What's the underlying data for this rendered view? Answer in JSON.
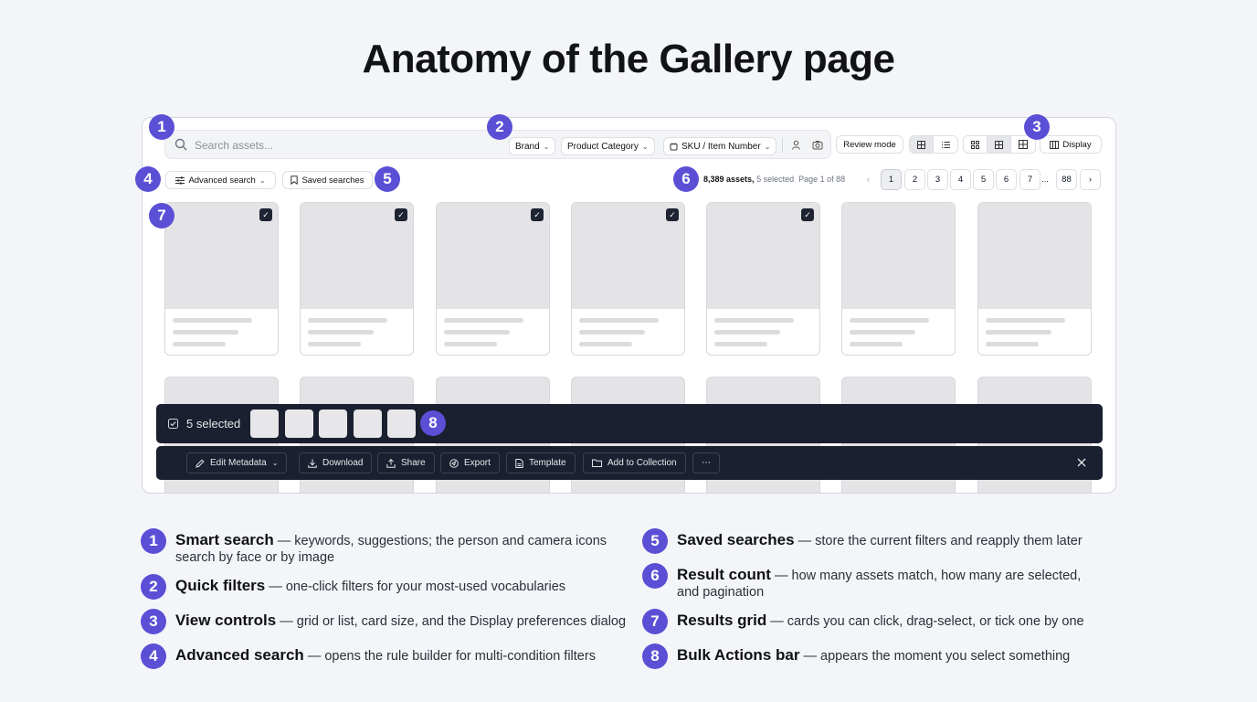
{
  "title": "Anatomy of the Gallery page",
  "search": {
    "placeholder": "Search assets...",
    "chips": [
      "Brand",
      "Product Category",
      "SKU / Item Number"
    ]
  },
  "toolbar": {
    "review_mode": "Review mode",
    "display": "Display",
    "advanced_search": "Advanced search",
    "saved_searches": "Saved searches"
  },
  "results": {
    "count": "8,389 assets,",
    "selected": "5 selected",
    "page_info": "Page 1 of 88",
    "pages": [
      "1",
      "2",
      "3",
      "4",
      "5",
      "6",
      "7"
    ],
    "ellipsis": "...",
    "last_page": "88",
    "current_page": 1
  },
  "bulk": {
    "selected_label": "5 selected",
    "actions": [
      "Edit Metadata",
      "Download",
      "Share",
      "Export",
      "Template",
      "Add to Collection"
    ],
    "more": "⋯"
  },
  "badges": [
    "1",
    "2",
    "3",
    "4",
    "5",
    "6",
    "7",
    "8"
  ],
  "legend": [
    {
      "num": "1",
      "term": "Smart search",
      "desc": " — keywords, suggestions; the person and camera icons search by face or by image"
    },
    {
      "num": "2",
      "term": "Quick filters",
      "desc": " — one-click filters for your most-used vocabularies"
    },
    {
      "num": "3",
      "term": "View controls",
      "desc": " — grid or list, card size, and the Display preferences dialog"
    },
    {
      "num": "4",
      "term": "Advanced search",
      "desc": " — opens the rule builder for multi-condition filters"
    },
    {
      "num": "5",
      "term": "Saved searches",
      "desc": " — store the current filters and reapply them later"
    },
    {
      "num": "6",
      "term": "Result count",
      "desc": " — how many assets match, how many are selected, and pagination"
    },
    {
      "num": "7",
      "term": "Results grid",
      "desc": " — cards you can click, drag-select, or tick one by one"
    },
    {
      "num": "8",
      "term": "Bulk Actions bar",
      "desc": " — appears the moment you select something"
    }
  ],
  "colors": {
    "accent": "#5b4fd6",
    "bulk_bar": "#1b2030",
    "background": "#f4f5f9"
  }
}
